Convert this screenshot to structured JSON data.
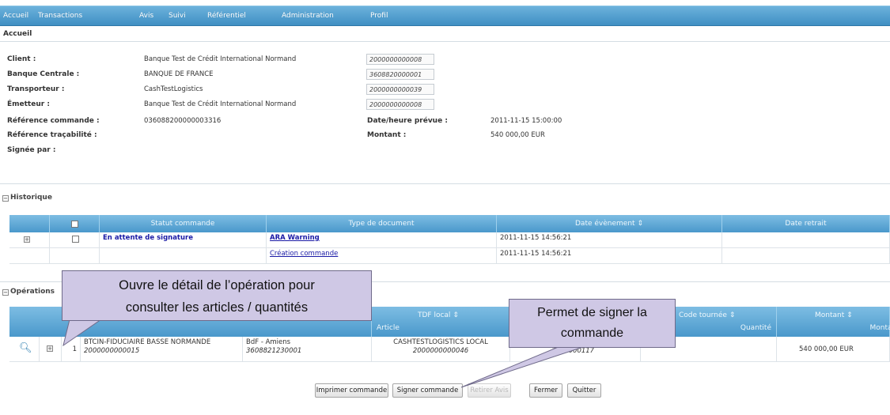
{
  "menu": {
    "items": [
      "Accueil",
      "Transactions",
      "Avis",
      "Suivi",
      "Référentiel",
      "Administration",
      "Profil"
    ]
  },
  "breadcrumb": "Accueil",
  "info": {
    "client_label": "Client :",
    "client_value": "Banque Test de Crédit International Normand",
    "client_code": "2000000000008",
    "banque_label": "Banque Centrale :",
    "banque_value": "BANQUE DE FRANCE",
    "banque_code": "3608820000001",
    "transporteur_label": "Transporteur :",
    "transporteur_value": "CashTestLogistics",
    "transporteur_code": "2000000000039",
    "emetteur_label": "Émetteur :",
    "emetteur_value": "Banque Test de Crédit International Normand",
    "emetteur_code": "2000000000008",
    "ref_cmd_label": "Référence commande :",
    "ref_cmd_value": "036088200000003316",
    "date_label": "Date/heure prévue :",
    "date_value": "2011-11-15 15:00:00",
    "ref_trac_label": "Référence traçabilité :",
    "montant_label": "Montant :",
    "montant_value": "540 000,00  EUR",
    "signee_label": "Signée par :"
  },
  "historique": {
    "title": "Historique",
    "headers": {
      "statut": "Statut commande",
      "type": "Type de document",
      "date_evt": "Date évènement",
      "date_retrait": "Date retrait"
    },
    "rows": [
      {
        "statut": "En attente de signature",
        "type": "ARA Warning",
        "date": "2011-11-15 14:56:21"
      },
      {
        "statut": "",
        "type": "Création commande",
        "date": "2011-11-15 14:56:21"
      }
    ]
  },
  "operations": {
    "title": "Opérations",
    "headers": {
      "tdf": "TDF local",
      "article": "Article",
      "code_tournee": "Code tournée",
      "quantite": "Quantité",
      "montant": "Montant",
      "montant2": "Montai"
    },
    "row": {
      "num": "1",
      "name": "BTCIN-FIDUCIAIRE BASSE NORMANDE",
      "name_code": "2000000000015",
      "bdf": "BdF - Amiens",
      "bdf_code": "3608821230001",
      "tdf": "CASHTESTLOGISTICS LOCAL",
      "tdf_code": "2000000000046",
      "tour_code": "7001000117",
      "montant": "540 000,00 EUR"
    }
  },
  "buttons": {
    "imprimer": "Imprimer commande",
    "signer": "Signer commande",
    "retirer": "Retirer Avis",
    "fermer": "Fermer",
    "quitter": "Quitter"
  },
  "callouts": {
    "left_line1": "Ouvre le détail de l’opération pour",
    "left_line2": "consulter les articles / quantités",
    "right_line1": "Permet de signer la",
    "right_line2": "commande"
  },
  "colors": {
    "menu_bar": "#4a98cb",
    "grid_header": "#5fa7d4",
    "link": "#1a1aa6",
    "callout_bg": "#cfc8e5"
  },
  "icons": {
    "detail": "magnifier-icon",
    "expand": "expand-plus-icon",
    "collapse": "collapse-minus-icon"
  }
}
